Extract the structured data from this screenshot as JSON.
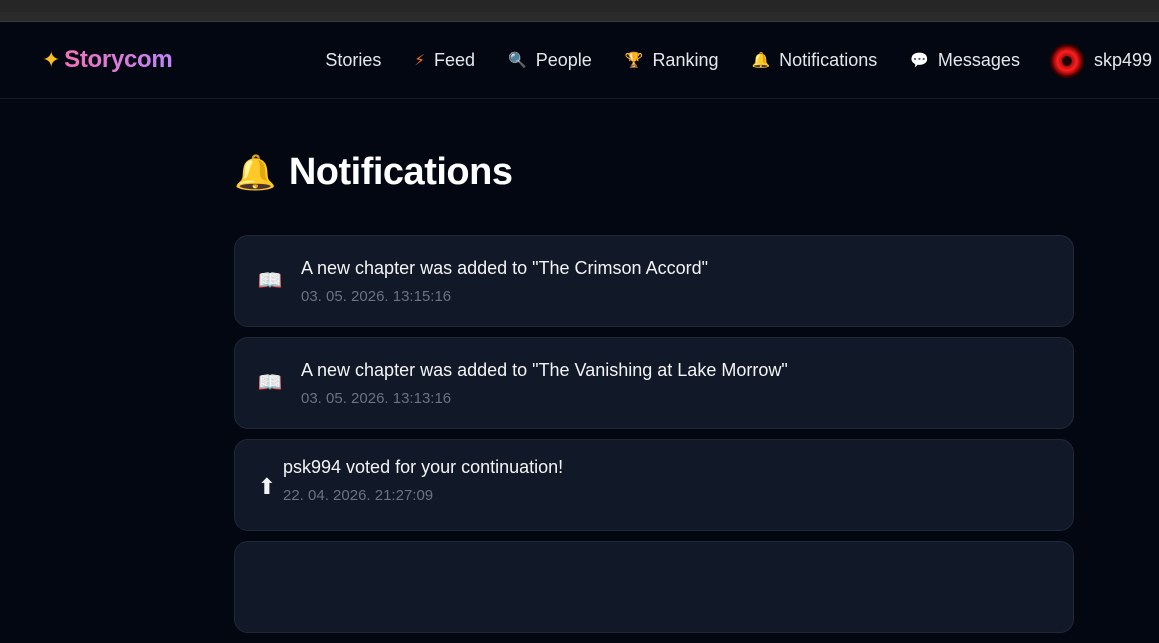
{
  "brand": {
    "spark": "✦",
    "name": "Storycom"
  },
  "nav": {
    "items": [
      {
        "label": "Stories",
        "icon": ""
      },
      {
        "label": "Feed",
        "icon": "⚡"
      },
      {
        "label": "People",
        "icon": "🔍"
      },
      {
        "label": "Ranking",
        "icon": "🏆"
      },
      {
        "label": "Notifications",
        "icon": "🔔"
      },
      {
        "label": "Messages",
        "icon": "💬"
      }
    ],
    "user": "skp499"
  },
  "page": {
    "title_icon": "🔔",
    "title": "Notifications"
  },
  "notifications": [
    {
      "icon": "📖",
      "text": "A new chapter was added to \"The Crimson Accord\"",
      "time": "03. 05. 2026. 13:15:16"
    },
    {
      "icon": "📖",
      "text": "A new chapter was added to \"The Vanishing at Lake Morrow\"",
      "time": "03. 05. 2026. 13:13:16"
    },
    {
      "icon": "⬆",
      "text": "psk994 voted for your continuation!",
      "time": "22. 04. 2026. 21:27:09"
    }
  ],
  "colors": {
    "background": "#030712",
    "card": "#111827",
    "accent_pink": "#f472b6",
    "accent_purple": "#c084fc"
  }
}
